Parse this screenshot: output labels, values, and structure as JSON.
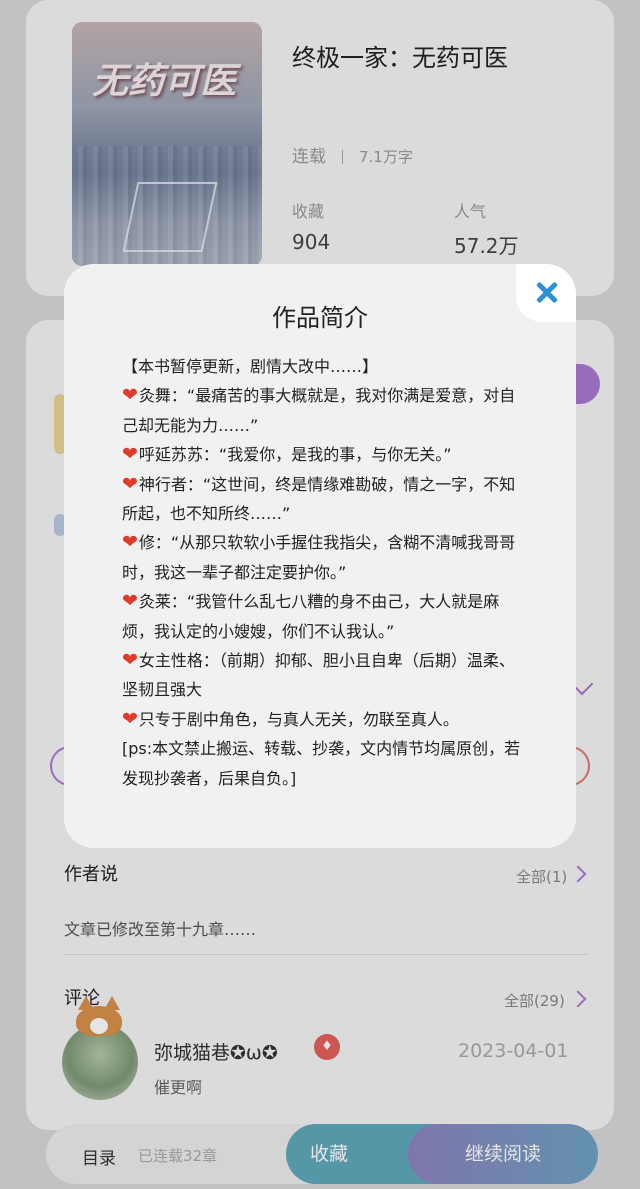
{
  "book": {
    "cover_title": "无药可医",
    "title": "终极一家：无药可医",
    "status": "连载",
    "word_count": "7.1万字",
    "stats": [
      {
        "label": "收藏",
        "value": "904"
      },
      {
        "label": "人气",
        "value": "57.2万"
      }
    ]
  },
  "sections": {
    "author_says": {
      "title": "作者说",
      "more": "全部(1)",
      "text": "文章已修改至第十九章……"
    },
    "comments": {
      "title": "评论",
      "more": "全部(29)"
    }
  },
  "comment": {
    "user": "弥城猫巷✪ω✪",
    "badge_icon": "vip-badge-icon",
    "date": "2023-04-01",
    "text": "催更啊"
  },
  "bottom_bar": {
    "toc": "目录",
    "chapters": "已连载32章",
    "collect": "收藏",
    "read": "继续阅读"
  },
  "modal": {
    "title": "作品简介",
    "close_icon": "close-icon",
    "heart_glyph": "❤",
    "lines": [
      {
        "heart": false,
        "text": "【本书暂停更新，剧情大改中……】"
      },
      {
        "heart": true,
        "text": "灸舞：“最痛苦的事大概就是，我对你满是爱意，对自己却无能为力……”"
      },
      {
        "heart": true,
        "text": "呼延苏苏：“我爱你，是我的事，与你无关。”"
      },
      {
        "heart": true,
        "text": "神行者：“这世间，终是情缘难勘破，情之一字，不知所起，也不知所终……”"
      },
      {
        "heart": true,
        "text": "修：“从那只软软小手握住我指尖，含糊不清喊我哥哥时，我这一辈子都注定要护你。”"
      },
      {
        "heart": true,
        "text": "灸莱：“我管什么乱七八糟的身不由己，大人就是麻烦，我认定的小嫂嫂，你们不认我认。”"
      },
      {
        "heart": true,
        "text": "女主性格：（前期）抑郁、胆小且自卑（后期）温柔、坚韧且强大"
      },
      {
        "heart": true,
        "text": "只专于剧中角色，与真人无关，勿联至真人。"
      },
      {
        "heart": false,
        "text": "[ps:本文禁止搬运、转载、抄袭，文内情节均属原创，若发现抄袭者，后果自负。]"
      }
    ]
  },
  "colors": {
    "accent_purple": "#a97ad1",
    "close_blue": "#2e8fd9",
    "heart_red": "#e03a2b",
    "collect_btn": "#5fa8ba"
  }
}
